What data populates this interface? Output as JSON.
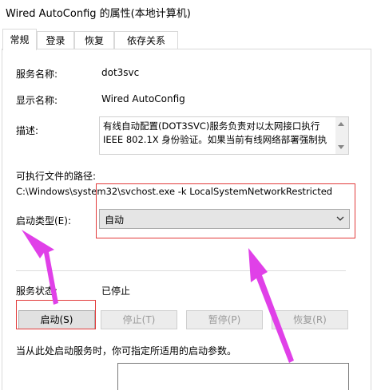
{
  "window": {
    "title": "Wired AutoConfig 的属性(本地计算机)"
  },
  "tabs": [
    {
      "label": "常规",
      "active": true
    },
    {
      "label": "登录",
      "active": false
    },
    {
      "label": "恢复",
      "active": false
    },
    {
      "label": "依存关系",
      "active": false
    }
  ],
  "general": {
    "service_name_label": "服务名称:",
    "service_name_value": "dot3svc",
    "display_name_label": "显示名称:",
    "display_name_value": "Wired AutoConfig",
    "description_label": "描述:",
    "description_text": "有线自动配置(DOT3SVC)服务负责对以太网接口执行\nIEEE 802.1X 身份验证。如果当前有线网络部署强制执",
    "exe_path_label": "可执行文件的路径:",
    "exe_path_value": "C:\\Windows\\system32\\svchost.exe -k LocalSystemNetworkRestricted",
    "startup_type_label": "启动类型(E):",
    "startup_type_value": "自动",
    "service_status_label": "服务状态:",
    "service_status_value": "已停止",
    "start_params_hint": "当从此处启动服务时，你可指定所适用的启动参数。"
  },
  "buttons": {
    "start": "启动(S)",
    "stop": "停止(T)",
    "pause": "暂停(P)",
    "resume": "恢复(R)"
  },
  "colors": {
    "annotation_highlight": "#e23b3b",
    "annotation_arrow": "#e040e8"
  }
}
